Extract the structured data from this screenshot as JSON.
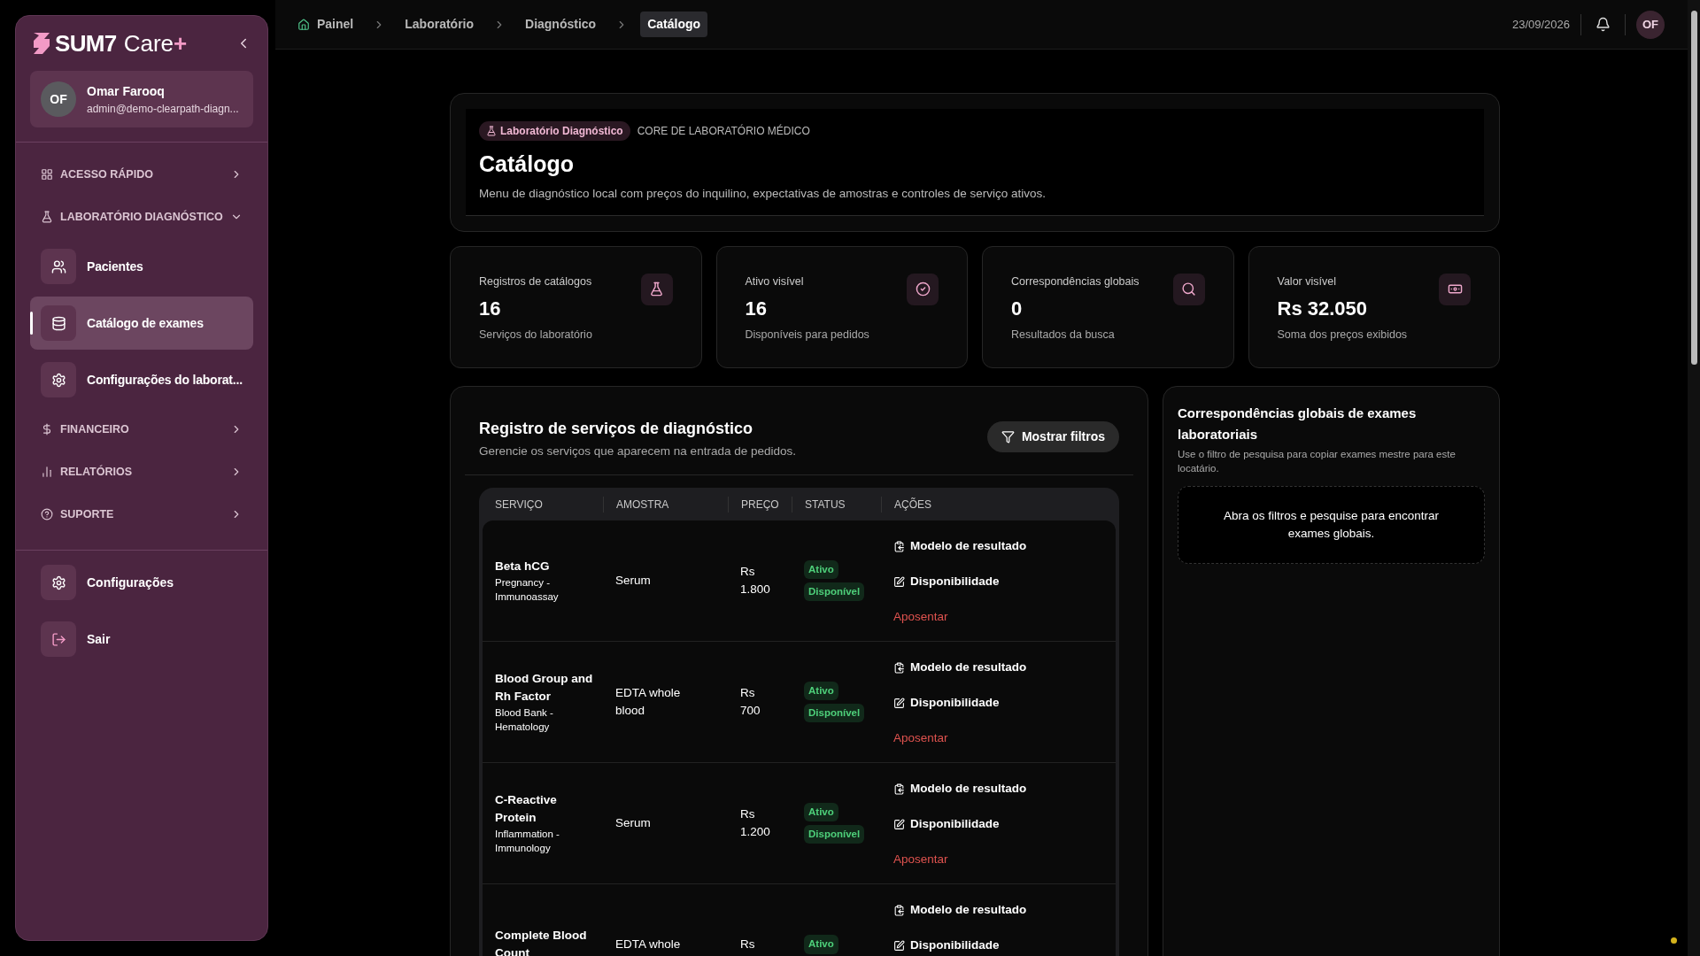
{
  "sidebar": {
    "brand": "SUM7",
    "brand_suffix": "Care",
    "brand_plus": "+",
    "user": {
      "initials": "OF",
      "name": "Omar Farooq",
      "email": "admin@demo-clearpath-diagn..."
    },
    "nav": [
      {
        "kind": "section",
        "label": "ACESSO RÁPIDO",
        "expanded": false
      },
      {
        "kind": "section",
        "label": "LABORATÓRIO DIAGNÓSTICO",
        "expanded": true
      },
      {
        "kind": "item",
        "label": "Pacientes",
        "selected": false
      },
      {
        "kind": "item",
        "label": "Catálogo de exames",
        "selected": true
      },
      {
        "kind": "item",
        "label": "Configurações do laborat...",
        "selected": false
      },
      {
        "kind": "section",
        "label": "FINANCEIRO",
        "expanded": false
      },
      {
        "kind": "section",
        "label": "RELATÓRIOS",
        "expanded": false
      },
      {
        "kind": "section",
        "label": "SUPORTE",
        "expanded": false
      }
    ],
    "footer": [
      {
        "label": "Configurações"
      },
      {
        "label": "Sair"
      }
    ]
  },
  "breadcrumbs": [
    {
      "label": "Painel",
      "selected": false
    },
    {
      "label": "Laboratório",
      "selected": false
    },
    {
      "label": "Diagnóstico",
      "selected": false
    },
    {
      "label": "Catálogo",
      "selected": true
    }
  ],
  "topbar": {
    "date": "23/09/2026",
    "avatar": "OF"
  },
  "header": {
    "badge": "Laboratório Diagnóstico",
    "eyebrow": "CORE DE LABORATÓRIO MÉDICO",
    "title": "Catálogo",
    "description": "Menu de diagnóstico local com preços do inquilino, expectativas de amostras e controles de serviço ativos."
  },
  "stats": [
    {
      "label": "Registros de catálogos",
      "value": "16",
      "caption": "Serviços do laboratório"
    },
    {
      "label": "Ativo visível",
      "value": "16",
      "caption": "Disponíveis para pedidos"
    },
    {
      "label": "Correspondências globais",
      "value": "0",
      "caption": "Resultados da busca"
    },
    {
      "label": "Valor visível",
      "value": "Rs 32.050",
      "caption": "Soma dos preços exibidos"
    }
  ],
  "registry": {
    "title": "Registro de serviços de diagnóstico",
    "subtitle": "Gerencie os serviços que aparecem na entrada de pedidos.",
    "filter_button": "Mostrar filtros",
    "columns": [
      "SERVIÇO",
      "AMOSTRA",
      "PREÇO",
      "STATUS",
      "AÇÕES"
    ],
    "rows": [
      {
        "name": "Beta hCG",
        "category": "Pregnancy - Immunoassay",
        "sample": "Serum",
        "price": "Rs 1.800",
        "statuses": [
          "Ativo",
          "Disponível"
        ],
        "actions": [
          "Modelo de resultado",
          "Disponibilidade",
          "Aposentar"
        ]
      },
      {
        "name": "Blood Group and Rh Factor",
        "category": "Blood Bank - Hematology",
        "sample": "EDTA whole blood",
        "price": "Rs 700",
        "statuses": [
          "Ativo",
          "Disponível"
        ],
        "actions": [
          "Modelo de resultado",
          "Disponibilidade",
          "Aposentar"
        ]
      },
      {
        "name": "C-Reactive Protein",
        "category": "Inflammation - Immunology",
        "sample": "Serum",
        "price": "Rs 1.200",
        "statuses": [
          "Ativo",
          "Disponível"
        ],
        "actions": [
          "Modelo de resultado",
          "Disponibilidade",
          "Aposentar"
        ]
      },
      {
        "name": "Complete Blood Count",
        "sample": "EDTA whole",
        "price": "Rs",
        "statuses": [
          "Ativo"
        ],
        "actions": [
          "Modelo de resultado",
          "Disponibilidade"
        ]
      }
    ]
  },
  "global_panel": {
    "title": "Correspondências globais de exames laboratoriais",
    "subtitle": "Use o filtro de pesquisa para copiar exames mestre para este locatário.",
    "empty": "Abra os filtros e pesquise para encontrar exames globais."
  }
}
